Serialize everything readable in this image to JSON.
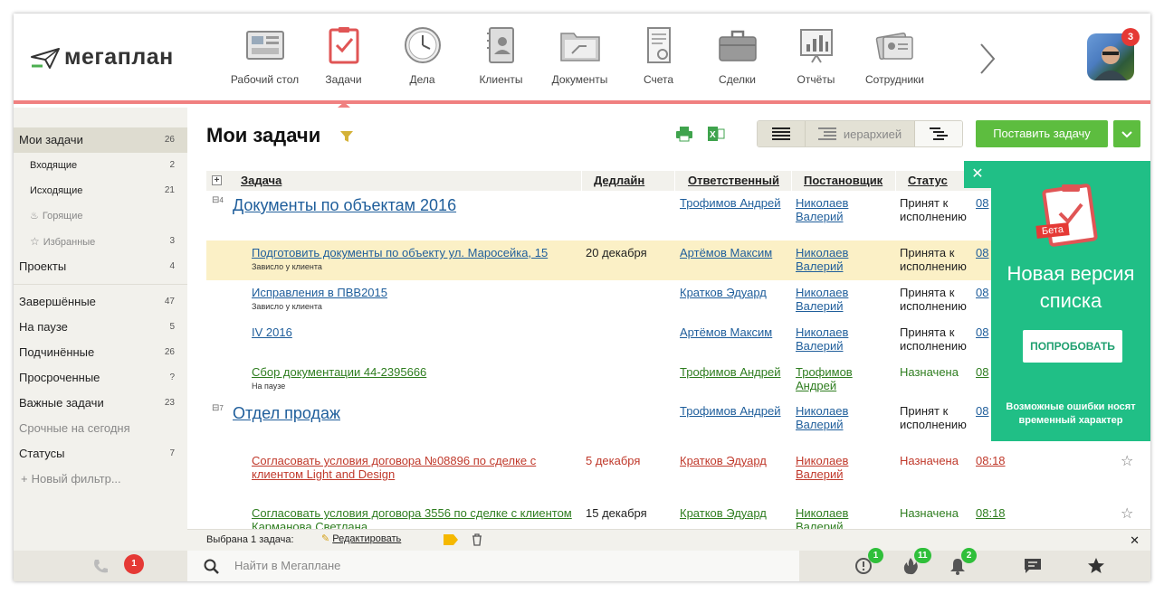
{
  "brand": {
    "name": "мегаплан"
  },
  "nav": {
    "items": [
      {
        "label": "Рабочий стол",
        "icon": "desktop-icon"
      },
      {
        "label": "Задачи",
        "icon": "tasks-icon",
        "active": true
      },
      {
        "label": "Дела",
        "icon": "clock-icon"
      },
      {
        "label": "Клиенты",
        "icon": "contacts-icon"
      },
      {
        "label": "Документы",
        "icon": "folder-icon"
      },
      {
        "label": "Счета",
        "icon": "invoice-icon"
      },
      {
        "label": "Сделки",
        "icon": "briefcase-icon"
      },
      {
        "label": "Отчёты",
        "icon": "report-icon"
      },
      {
        "label": "Сотрудники",
        "icon": "employees-icon"
      }
    ]
  },
  "user": {
    "notifications": "3"
  },
  "sidebar": {
    "items": [
      {
        "label": "Мои задачи",
        "count": "26"
      },
      {
        "label": "Входящие",
        "count": "2"
      },
      {
        "label": "Исходящие",
        "count": "21"
      },
      {
        "label": "Горящие",
        "count": ""
      },
      {
        "label": "Избранные",
        "count": "3"
      },
      {
        "label": "Проекты",
        "count": "4"
      },
      {
        "label": "Завершённые",
        "count": "47"
      },
      {
        "label": "На паузе",
        "count": "5"
      },
      {
        "label": "Подчинённые",
        "count": "26"
      },
      {
        "label": "Просроченные",
        "count": "?"
      },
      {
        "label": "Важные задачи",
        "count": "23"
      },
      {
        "label": "Срочные на сегодня",
        "count": ""
      },
      {
        "label": "Статусы",
        "count": "7"
      }
    ],
    "new_filter": "Новый фильтр..."
  },
  "page": {
    "title": "Мои задачи",
    "view_hierarchy": "иерархией",
    "add_task": "Поставить задачу"
  },
  "table": {
    "columns": [
      "Задача",
      "Дедлайн",
      "Ответственный",
      "Постановщик",
      "Статус"
    ],
    "groups": [
      {
        "count": "4",
        "title": "Документы по объектам 2016",
        "resp": "Трофимов Андрей",
        "owner": [
          "Николаев",
          "Валерий"
        ],
        "status": [
          "Принят к",
          "исполнению"
        ],
        "time": "08"
      },
      {
        "count": "7",
        "title": "Отдел продаж",
        "resp": "Трофимов Андрей",
        "owner": [
          "Николаев",
          "Валерий"
        ],
        "status": [
          "Принят к",
          "исполнению"
        ],
        "time": "08"
      }
    ],
    "rows": [
      {
        "task": "Подготовить документы по объекту ул. Маросейка, 15",
        "note": "Зависло у клиента",
        "deadline": "20 декабря",
        "resp": "Артёмов Максим",
        "owner": [
          "Николаев",
          "Валерий"
        ],
        "status": [
          "Принята к",
          "исполнению"
        ],
        "time": "08"
      },
      {
        "task": "Исправления в ПВВ2015",
        "note": "Зависло у клиента",
        "deadline": "",
        "resp": "Кратков Эдуард",
        "owner": [
          "Николаев",
          "Валерий"
        ],
        "status": [
          "Принята к",
          "исполнению"
        ],
        "time": "08"
      },
      {
        "task": "IV 2016",
        "note": "",
        "deadline": "",
        "resp": "Артёмов Максим",
        "owner": [
          "Николаев",
          "Валерий"
        ],
        "status": [
          "Принята к",
          "исполнению"
        ],
        "time": "08"
      },
      {
        "task": "Сбор документации 44-2395666",
        "note": "На паузе",
        "deadline": "",
        "resp": "Трофимов Андрей",
        "owner": [
          "Трофимов",
          "Андрей"
        ],
        "status": [
          "Назначена",
          ""
        ],
        "time": "08"
      },
      {
        "task": "Согласовать условия договора №08896 по сделке с",
        "task2": "клиентом Light and Design",
        "note": "",
        "deadline": "5 декабря",
        "resp": "Кратков Эдуард",
        "owner": [
          "Николаев",
          "Валерий"
        ],
        "status": [
          "Назначена",
          ""
        ],
        "time": "08:18"
      },
      {
        "task": "Согласовать условия договора 3556 по сделке с клиентом",
        "task2": "Карманова Светлана",
        "note": "",
        "deadline": "15 декабря",
        "resp": "Кратков Эдуард",
        "owner": [
          "Николаев",
          "Валерий"
        ],
        "status": [
          "Назначена",
          ""
        ],
        "time": "08:18"
      }
    ]
  },
  "promo": {
    "badge": "Бета",
    "title_line1": "Новая версия",
    "title_line2": "списка",
    "button": "ПОПРОБОВАТЬ",
    "note_line1": "Возможные ошибки носят",
    "note_line2": "временный характер"
  },
  "selection": {
    "text": "Выбрана 1 задача:",
    "edit": "Редактировать"
  },
  "statusbar": {
    "calls": "1",
    "search_placeholder": "Найти в Мегаплане",
    "alerts": "1",
    "hot": "11",
    "bell": "2"
  },
  "colors": {
    "accent": "#f08080",
    "green": "#5dbd3f",
    "promo": "#20bf86",
    "link": "#1f5e9b"
  }
}
